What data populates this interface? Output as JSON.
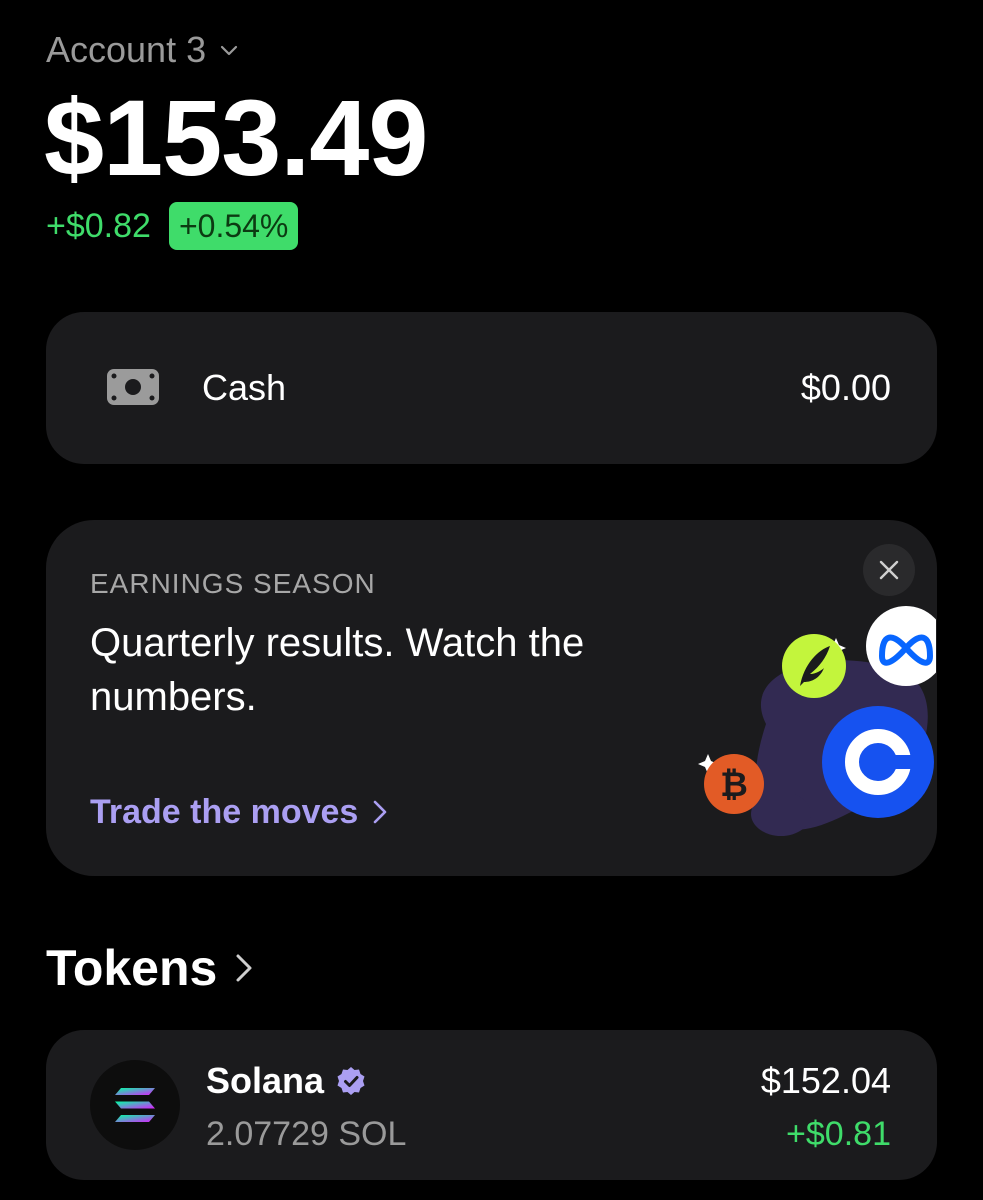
{
  "header": {
    "account_name": "Account 3",
    "balance": "$153.49",
    "change_abs": "+$0.82",
    "change_pct": "+0.54%"
  },
  "cash": {
    "label": "Cash",
    "value": "$0.00",
    "icon": "cash-icon"
  },
  "promo": {
    "eyebrow": "EARNINGS SEASON",
    "title": "Quarterly results. Watch the numbers.",
    "cta_label": "Trade the moves",
    "close_icon": "close-icon",
    "art_icons": [
      "robinhood-logo-icon",
      "meta-logo-icon",
      "coinbase-logo-icon",
      "bitcoin-logo-icon"
    ]
  },
  "tokens": {
    "title": "Tokens",
    "items": [
      {
        "name": "Solana",
        "amount": "2.07729 SOL",
        "value": "$152.04",
        "change": "+$0.81",
        "icon": "solana-logo-icon",
        "verified": true
      }
    ]
  },
  "colors": {
    "background": "#000000",
    "card": "#1b1b1d",
    "positive": "#3fdc6a",
    "accent": "#ab9ff2",
    "muted": "#9a9a9a"
  }
}
